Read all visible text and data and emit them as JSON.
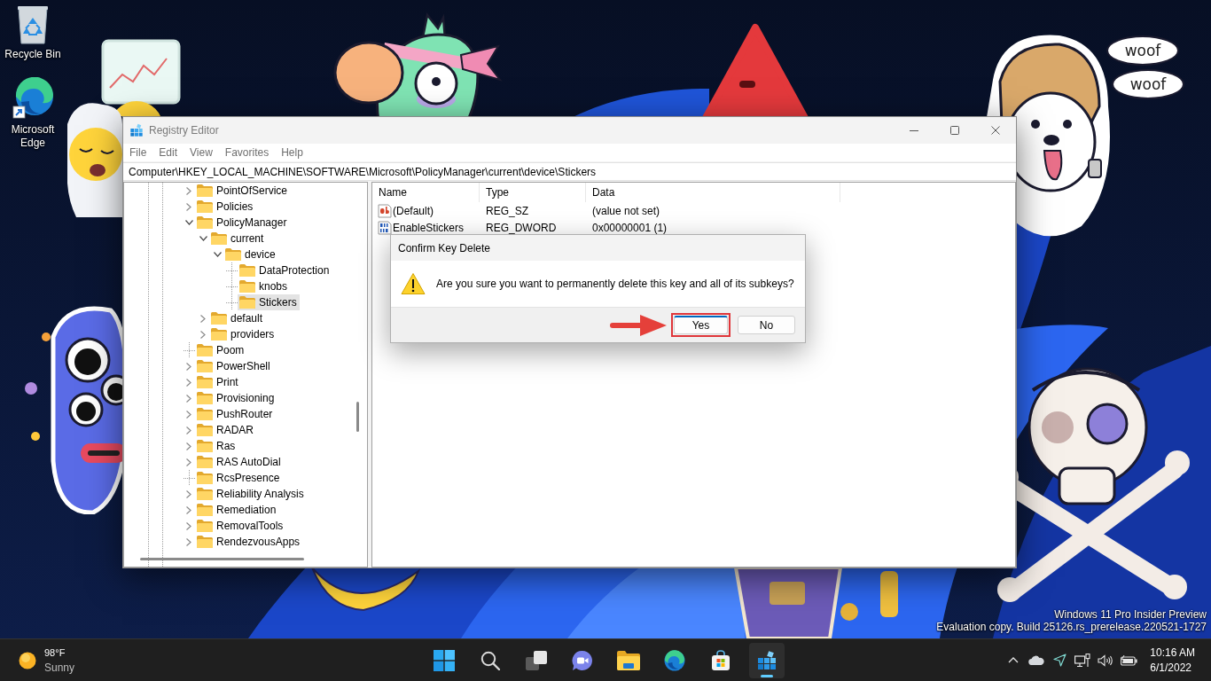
{
  "desktop": {
    "icons": [
      {
        "label": "Recycle Bin",
        "kind": "recycle-bin"
      },
      {
        "label": "Microsoft Edge",
        "kind": "browser-shortcut"
      }
    ],
    "sticker_speech": [
      "woof",
      "woof"
    ],
    "build_notice": [
      "Windows 11 Pro Insider Preview",
      "Evaluation copy. Build 25126.rs_prerelease.220521-1727"
    ]
  },
  "registry_window": {
    "title": "Registry Editor",
    "menu": [
      "File",
      "Edit",
      "View",
      "Favorites",
      "Help"
    ],
    "address": "Computer\\HKEY_LOCAL_MACHINE\\SOFTWARE\\Microsoft\\PolicyManager\\current\\device\\Stickers",
    "tree": [
      {
        "label": "PointOfService",
        "expanded": false,
        "selected": false
      },
      {
        "label": "Policies",
        "expanded": false,
        "selected": false
      },
      {
        "label": "PolicyManager",
        "expanded": true,
        "selected": false,
        "children": [
          {
            "label": "current",
            "expanded": true,
            "selected": false,
            "children": [
              {
                "label": "device",
                "expanded": true,
                "selected": false,
                "children": [
                  {
                    "label": "DataProtection",
                    "selected": false
                  },
                  {
                    "label": "knobs",
                    "selected": false
                  },
                  {
                    "label": "Stickers",
                    "selected": true
                  }
                ]
              }
            ]
          },
          {
            "label": "default",
            "expanded": false,
            "selected": false
          },
          {
            "label": "providers",
            "expanded": false,
            "selected": false
          }
        ]
      },
      {
        "label": "Poom",
        "selected": false
      },
      {
        "label": "PowerShell",
        "expanded": false,
        "selected": false
      },
      {
        "label": "Print",
        "expanded": false,
        "selected": false
      },
      {
        "label": "Provisioning",
        "expanded": false,
        "selected": false
      },
      {
        "label": "PushRouter",
        "expanded": false,
        "selected": false
      },
      {
        "label": "RADAR",
        "expanded": false,
        "selected": false
      },
      {
        "label": "Ras",
        "expanded": false,
        "selected": false
      },
      {
        "label": "RAS AutoDial",
        "expanded": false,
        "selected": false
      },
      {
        "label": "RcsPresence",
        "selected": false
      },
      {
        "label": "Reliability Analysis",
        "expanded": false,
        "selected": false
      },
      {
        "label": "Remediation",
        "expanded": false,
        "selected": false
      },
      {
        "label": "RemovalTools",
        "expanded": false,
        "selected": false
      },
      {
        "label": "RendezvousApps",
        "expanded": false,
        "selected": false
      }
    ],
    "columns": [
      "Name",
      "Type",
      "Data"
    ],
    "values": [
      {
        "kind": "string",
        "name": "(Default)",
        "type": "REG_SZ",
        "data": "(value not set)"
      },
      {
        "kind": "binary",
        "name": "EnableStickers",
        "type": "REG_DWORD",
        "data": "0x00000001 (1)"
      }
    ]
  },
  "dialog": {
    "title": "Confirm Key Delete",
    "message": "Are you sure you want to permanently delete this key and all of its subkeys?",
    "buttons": [
      {
        "label": "Yes",
        "default": true,
        "highlighted": true
      },
      {
        "label": "No",
        "default": false,
        "highlighted": false
      }
    ]
  },
  "taskbar": {
    "weather": {
      "temperature": "98°F",
      "condition": "Sunny"
    },
    "apps": [
      {
        "kind": "start",
        "active": false
      },
      {
        "kind": "search",
        "active": false
      },
      {
        "kind": "task-view",
        "active": false
      },
      {
        "kind": "chat",
        "active": false
      },
      {
        "kind": "file-explorer",
        "active": false
      },
      {
        "kind": "browser",
        "active": false
      },
      {
        "kind": "store",
        "active": false
      },
      {
        "kind": "registry-editor",
        "active": true
      }
    ],
    "clock": {
      "time": "10:16 AM",
      "date": "6/1/2022"
    }
  }
}
